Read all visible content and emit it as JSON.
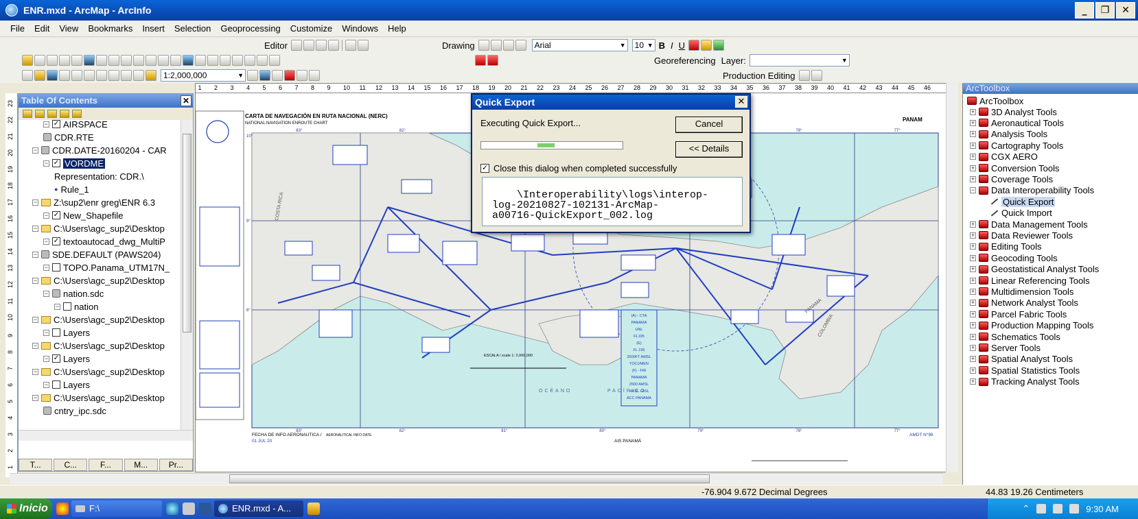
{
  "window": {
    "title": "ENR.mxd - ArcMap - ArcInfo",
    "minimize": "_",
    "restore": "❐",
    "close": "✕"
  },
  "menubar": [
    "File",
    "Edit",
    "View",
    "Bookmarks",
    "Insert",
    "Selection",
    "Geoprocessing",
    "Customize",
    "Windows",
    "Help"
  ],
  "toolbars": {
    "editor": "Editor",
    "drawing": "Drawing",
    "font_name": "Arial",
    "font_size": "10",
    "bold": "B",
    "italic": "I",
    "underline": "U",
    "georeferencing": "Georeferencing",
    "layer_label": "Layer:",
    "scale": "1:2,000,000",
    "production_editing": "Production Editing"
  },
  "toc": {
    "title": "Table Of Contents",
    "items": [
      {
        "label": "AIRSPACE",
        "checked": true,
        "type": "layer"
      },
      {
        "label": "CDR.RTE",
        "type": "table"
      },
      {
        "label": "CDR.DATE-20160204 - CAR",
        "type": "db"
      },
      {
        "label": "VORDME",
        "checked": true,
        "selected": true,
        "type": "layer"
      },
      {
        "label": "Representation: CDR.\\",
        "type": "text"
      },
      {
        "label": "Rule_1",
        "type": "symbol"
      },
      {
        "label": "Z:\\sup2\\enr greg\\ENR 6.3",
        "type": "folder"
      },
      {
        "label": "New_Shapefile",
        "checked": true,
        "type": "layer"
      },
      {
        "label": "C:\\Users\\agc_sup2\\Desktop",
        "type": "folder"
      },
      {
        "label": "textoautocad_dwg_MultiP",
        "checked": true,
        "type": "layer"
      },
      {
        "label": "SDE.DEFAULT (PAWS204)",
        "type": "db"
      },
      {
        "label": "TOPO.Panama_UTM17N_",
        "checked": false,
        "type": "layer"
      },
      {
        "label": "C:\\Users\\agc_sup2\\Desktop",
        "type": "folder"
      },
      {
        "label": "nation.sdc",
        "type": "db"
      },
      {
        "label": "nation",
        "checked": false,
        "type": "layer"
      },
      {
        "label": "C:\\Users\\agc_sup2\\Desktop",
        "type": "folder"
      },
      {
        "label": "Layers",
        "checked": false,
        "type": "layer"
      },
      {
        "label": "C:\\Users\\agc_sup2\\Desktop",
        "type": "folder"
      },
      {
        "label": "Layers",
        "checked": true,
        "type": "layer"
      },
      {
        "label": "C:\\Users\\agc_sup2\\Desktop",
        "type": "folder"
      },
      {
        "label": "Layers",
        "checked": false,
        "type": "layer"
      },
      {
        "label": "C:\\Users\\agc_sup2\\Desktop",
        "type": "folder"
      },
      {
        "label": "cntry_ipc.sdc",
        "type": "table"
      }
    ],
    "tabs": [
      "T...",
      "C...",
      "F...",
      "M...",
      "Pr..."
    ]
  },
  "chart": {
    "title_es": "CARTA DE NAVEGACIÓN EN RUTA NACIONAL (NERC)",
    "title_en": "NATIONAL NAVIGATION ENROUTE CHART",
    "region_right": "PANAM",
    "country_costa_rica": "COSTA RICA",
    "country_panama": "PANAMA",
    "country_colombia": "COLOMBIA",
    "ocean_es": "OCÉANO",
    "ocean_en": "PACÍFICO",
    "scale_text": "ESCALA / scale 1: 2,000,000",
    "footer_left": "FECHA DE INFO AERONAUTICA /",
    "footer_left_en": "AERONAUTICAL INFO DATE",
    "footer_date": "01 JUL 20",
    "footer_center": "AIS PANAMÁ",
    "footer_right": "AMDT N°96",
    "top_labels": [
      "83°",
      "82°",
      "81°",
      "80°",
      "79°",
      "78°",
      "77°"
    ],
    "bottom_labels": [
      "83°",
      "82°",
      "81°",
      "80°",
      "79°",
      "78°",
      "77°"
    ],
    "lat_labels": [
      "10°",
      "9°",
      "8°"
    ],
    "airspace_box": [
      "(A) - CTA",
      "PANAMA",
      "UNL",
      "FL195",
      "(E)",
      "FL 195",
      "2500FT AMSL",
      "TOCUMEN",
      "(F) - FIR",
      "PANAMA",
      "2500 AMSL",
      "AMSL / ASL",
      "ACC PANAMA"
    ]
  },
  "dialog": {
    "title": "Quick Export",
    "status": "Executing Quick Export...",
    "cancel": "Cancel",
    "details": "<< Details",
    "progress": 0.48,
    "checkbox_label": "Close this dialog when completed successfully",
    "checkbox_checked": true,
    "log": "\\Interoperability\\logs\\interop-\nlog-20210827-102131-ArcMap-\na00716-QuickExport_002.log"
  },
  "arctoolbox": {
    "title": "ArcToolbox",
    "root": "ArcToolbox",
    "items": [
      {
        "label": "3D Analyst Tools",
        "type": "toolbox"
      },
      {
        "label": "Aeronautical Tools",
        "type": "toolbox"
      },
      {
        "label": "Analysis Tools",
        "type": "toolbox"
      },
      {
        "label": "Cartography Tools",
        "type": "toolbox"
      },
      {
        "label": "CGX AERO",
        "type": "toolbox"
      },
      {
        "label": "Conversion Tools",
        "type": "toolbox"
      },
      {
        "label": "Coverage Tools",
        "type": "toolbox"
      },
      {
        "label": "Data Interoperability Tools",
        "type": "toolbox",
        "expanded": true
      },
      {
        "label": "Quick Export",
        "type": "tool",
        "selected": true
      },
      {
        "label": "Quick Import",
        "type": "tool"
      },
      {
        "label": "Data Management Tools",
        "type": "toolbox"
      },
      {
        "label": "Data Reviewer Tools",
        "type": "toolbox"
      },
      {
        "label": "Editing Tools",
        "type": "toolbox"
      },
      {
        "label": "Geocoding Tools",
        "type": "toolbox"
      },
      {
        "label": "Geostatistical Analyst Tools",
        "type": "toolbox"
      },
      {
        "label": "Linear Referencing Tools",
        "type": "toolbox"
      },
      {
        "label": "Multidimension Tools",
        "type": "toolbox"
      },
      {
        "label": "Network Analyst Tools",
        "type": "toolbox"
      },
      {
        "label": "Parcel Fabric Tools",
        "type": "toolbox"
      },
      {
        "label": "Production Mapping Tools",
        "type": "toolbox"
      },
      {
        "label": "Schematics Tools",
        "type": "toolbox"
      },
      {
        "label": "Server Tools",
        "type": "toolbox"
      },
      {
        "label": "Spatial Analyst Tools",
        "type": "toolbox"
      },
      {
        "label": "Spatial Statistics Tools",
        "type": "toolbox"
      },
      {
        "label": "Tracking Analyst Tools",
        "type": "toolbox"
      }
    ]
  },
  "statusbar": {
    "coords": "-76.904  9.672 Decimal Degrees",
    "page": "44.83  19.26 Centimeters"
  },
  "taskbar": {
    "start": "Inicio",
    "tasks": [
      {
        "label": "F:\\"
      },
      {
        "label": "ENR.mxd - A...",
        "active": true
      }
    ],
    "clock": "9:30 AM"
  },
  "colors": {
    "titlebar": "#0a3fa5",
    "selection": "#0a246a",
    "sea": "#c9ecea",
    "route": "#1f3ec0"
  }
}
